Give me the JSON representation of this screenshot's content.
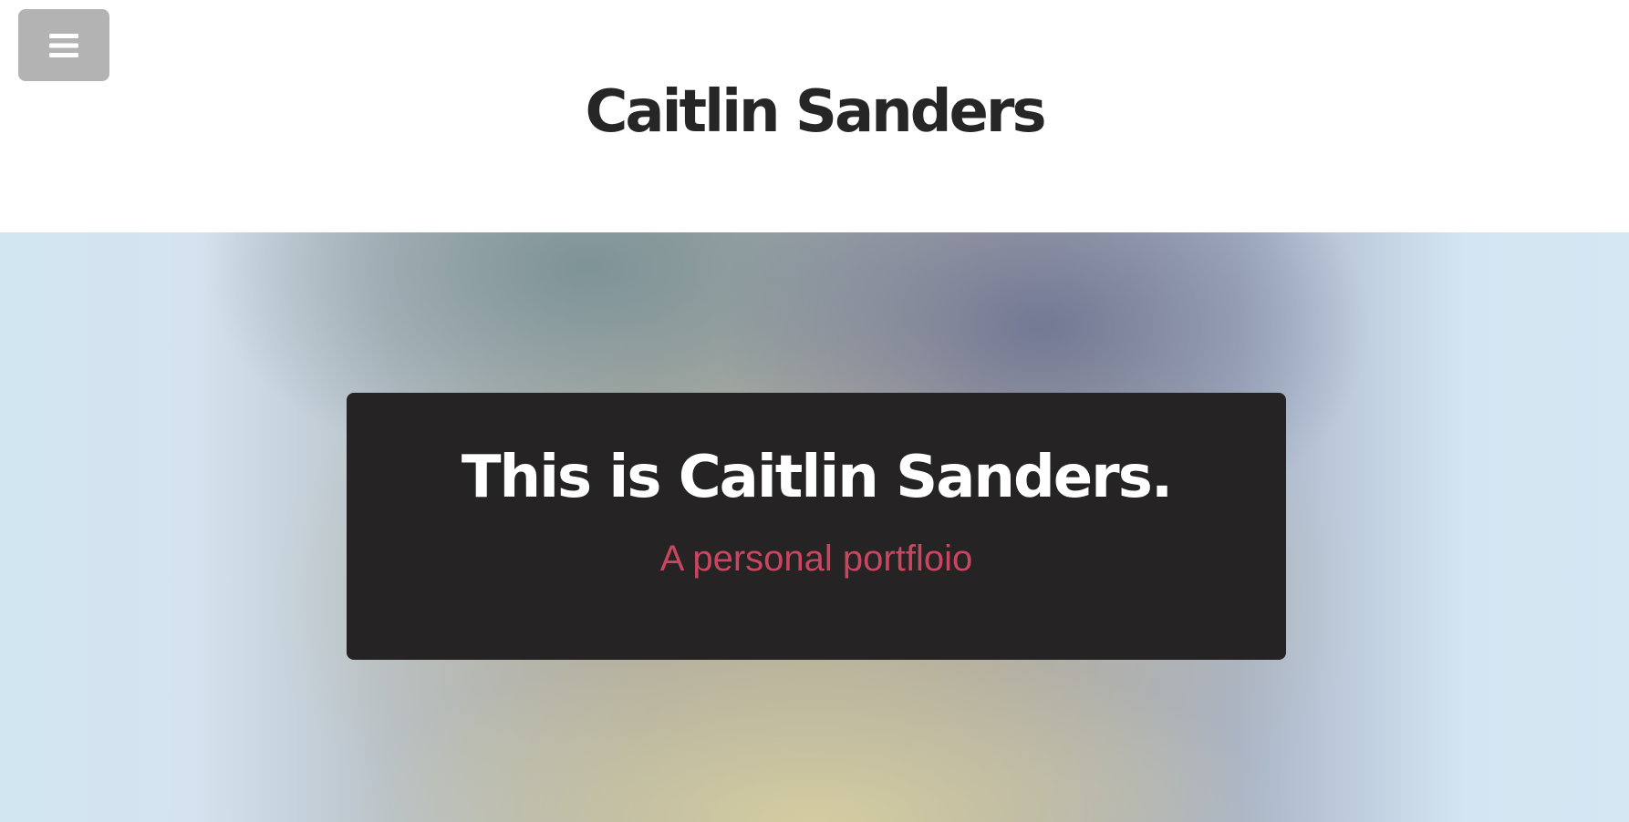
{
  "site": {
    "title": "Caitlin Sanders"
  },
  "hero": {
    "heading": "This is Caitlin Sanders.",
    "subtitle": "A personal portfloio"
  },
  "icons": {
    "menu": "hamburger-menu-icon"
  },
  "colors": {
    "menu_button_bg": "#b3b3b3",
    "title_text": "#262626",
    "card_bg": "#252323",
    "heading_text": "#ffffff",
    "subtitle_text": "#c94660"
  }
}
